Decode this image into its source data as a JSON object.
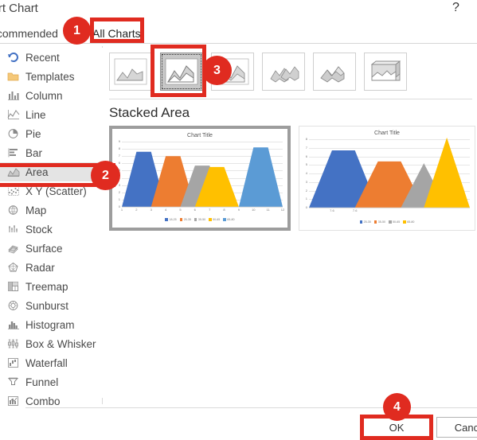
{
  "window": {
    "title": "sert Chart",
    "help_icon": "?"
  },
  "tabs": [
    {
      "label": "Recommended",
      "selected": false
    },
    {
      "label": "All Charts",
      "selected": true
    }
  ],
  "sidebar": {
    "items": [
      {
        "label": "Recent",
        "icon": "recent-icon",
        "selected": false
      },
      {
        "label": "Templates",
        "icon": "folder-icon",
        "selected": false
      },
      {
        "label": "Column",
        "icon": "column-icon",
        "selected": false
      },
      {
        "label": "Line",
        "icon": "line-icon",
        "selected": false
      },
      {
        "label": "Pie",
        "icon": "pie-icon",
        "selected": false
      },
      {
        "label": "Bar",
        "icon": "bar-icon",
        "selected": false
      },
      {
        "label": "Area",
        "icon": "area-icon",
        "selected": true
      },
      {
        "label": "X Y (Scatter)",
        "icon": "scatter-icon",
        "selected": false
      },
      {
        "label": "Map",
        "icon": "map-icon",
        "selected": false
      },
      {
        "label": "Stock",
        "icon": "stock-icon",
        "selected": false
      },
      {
        "label": "Surface",
        "icon": "surface-icon",
        "selected": false
      },
      {
        "label": "Radar",
        "icon": "radar-icon",
        "selected": false
      },
      {
        "label": "Treemap",
        "icon": "treemap-icon",
        "selected": false
      },
      {
        "label": "Sunburst",
        "icon": "sunburst-icon",
        "selected": false
      },
      {
        "label": "Histogram",
        "icon": "histogram-icon",
        "selected": false
      },
      {
        "label": "Box & Whisker",
        "icon": "boxwhisker-icon",
        "selected": false
      },
      {
        "label": "Waterfall",
        "icon": "waterfall-icon",
        "selected": false
      },
      {
        "label": "Funnel",
        "icon": "funnel-icon",
        "selected": false
      },
      {
        "label": "Combo",
        "icon": "combo-icon",
        "selected": false
      }
    ]
  },
  "chart_types": [
    {
      "name": "area-icon",
      "selected": false
    },
    {
      "name": "stacked-area-icon",
      "selected": true
    },
    {
      "name": "100-percent-stacked-area-icon",
      "selected": false
    },
    {
      "name": "3d-area-icon",
      "selected": false
    },
    {
      "name": "3d-stacked-area-icon",
      "selected": false
    },
    {
      "name": "3d-100-percent-stacked-area-icon",
      "selected": false
    }
  ],
  "section": {
    "heading": "Stacked Area"
  },
  "colors": {
    "accent_red": "#E02B20",
    "focus_blue": "#2f7fd1",
    "series1": "#4472C4",
    "series2": "#ED7D31",
    "series3": "#A5A5A5",
    "series4": "#FFC000",
    "series5": "#5B9BD5"
  },
  "footer": {
    "ok_label": "OK",
    "cancel_label": "Cancel"
  },
  "annotations": [
    {
      "number": "1",
      "target": "all-charts-tab"
    },
    {
      "number": "2",
      "target": "sidebar-item-area"
    },
    {
      "number": "3",
      "target": "stacked-area-type-icon"
    },
    {
      "number": "4",
      "target": "ok-button"
    }
  ],
  "chart_data": [
    {
      "id": "preview-stacked-area-1",
      "type": "area",
      "title": "Chart Title",
      "xlabel": "",
      "ylabel": "",
      "x": [
        1,
        2,
        3,
        4,
        5,
        6,
        7,
        8,
        9,
        10,
        11,
        12
      ],
      "xtick_labels": [
        "1",
        "2",
        "3",
        "4",
        "5",
        "6",
        "7",
        "8",
        "9",
        "10",
        "11",
        "12"
      ],
      "ytick_labels": [
        "0",
        "1",
        "2",
        "3",
        "4",
        "5",
        "6",
        "7",
        "8",
        "9"
      ],
      "ylim": [
        0,
        9
      ],
      "grid": true,
      "legend_position": "bottom",
      "series": [
        {
          "name": "18-25",
          "color": "#4472C4",
          "values": [
            0,
            7.6,
            7.6,
            0,
            0,
            0,
            0,
            0,
            0,
            0,
            0,
            0
          ]
        },
        {
          "name": "25-35",
          "color": "#ED7D31",
          "values": [
            0,
            0,
            0,
            7.0,
            7.0,
            0,
            0,
            0,
            0,
            0,
            0,
            0
          ]
        },
        {
          "name": "35-50",
          "color": "#A5A5A5",
          "values": [
            0,
            0,
            0,
            0,
            0,
            5.7,
            5.7,
            0,
            0,
            0,
            0,
            0
          ]
        },
        {
          "name": "50-65",
          "color": "#FFC000",
          "values": [
            0,
            0,
            0,
            0,
            0,
            0,
            5.5,
            5.5,
            0,
            0,
            0,
            0
          ]
        },
        {
          "name": "65-80",
          "color": "#5B9BD5",
          "values": [
            0,
            0,
            0,
            0,
            0,
            0,
            0,
            0,
            0,
            8.2,
            8.2,
            0
          ]
        }
      ]
    },
    {
      "id": "preview-stacked-area-2",
      "type": "area",
      "title": "Chart Title",
      "xlabel": "",
      "ylabel": "",
      "xtick_labels": [
        "7.6",
        "7.6"
      ],
      "ytick_labels": [
        "0",
        "1",
        "2",
        "3",
        "4",
        "5",
        "6",
        "7",
        "8"
      ],
      "ylim": [
        0,
        8
      ],
      "grid": true,
      "legend_position": "bottom",
      "series": [
        {
          "name": "25-35",
          "color": "#4472C4",
          "values": [
            0,
            6.7,
            6.7,
            0,
            0,
            0,
            0,
            0
          ]
        },
        {
          "name": "35-50",
          "color": "#ED7D31",
          "values": [
            0,
            0,
            0,
            5.4,
            5.4,
            0,
            0,
            0
          ]
        },
        {
          "name": "50-65",
          "color": "#A5A5A5",
          "values": [
            0,
            0,
            0,
            0,
            0,
            5.2,
            0,
            0
          ]
        },
        {
          "name": "65-80",
          "color": "#FFC000",
          "values": [
            0,
            0,
            0,
            0,
            0,
            0,
            8.2,
            0
          ]
        }
      ]
    }
  ]
}
